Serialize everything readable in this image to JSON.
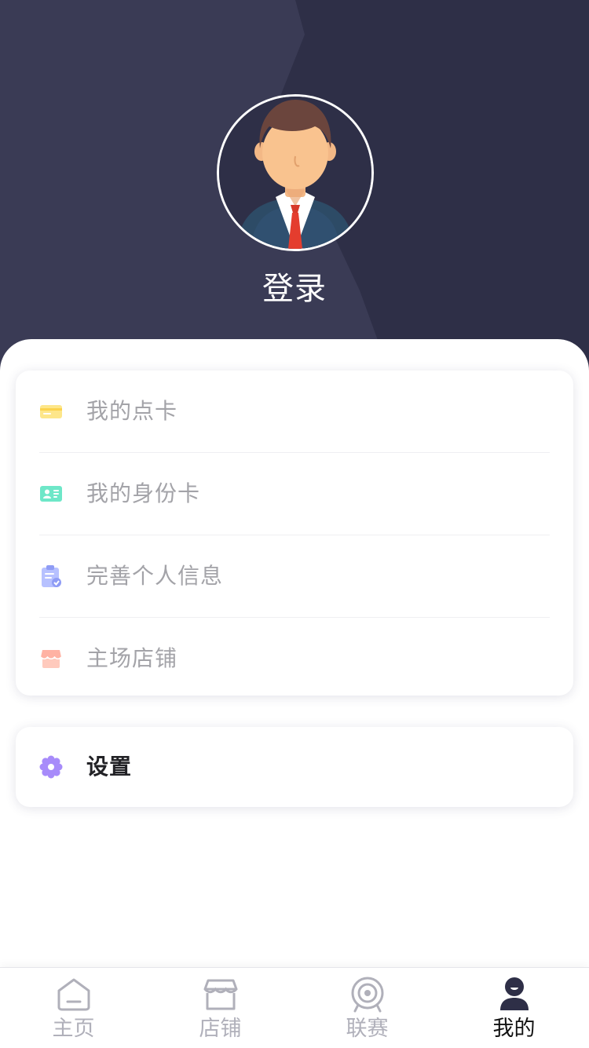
{
  "header": {
    "login_label": "登录"
  },
  "menu": {
    "items": [
      {
        "label": "我的点卡",
        "icon": "card-icon",
        "color": "#fde68a"
      },
      {
        "label": "我的身份卡",
        "icon": "id-card-icon",
        "color": "#6ee7c8"
      },
      {
        "label": "完善个人信息",
        "icon": "clipboard-check-icon",
        "color": "#a9b6ff"
      },
      {
        "label": "主场店铺",
        "icon": "store-icon",
        "color": "#ffb2a3"
      }
    ]
  },
  "settings": {
    "label": "设置",
    "icon": "gear-icon",
    "color": "#a78bfa"
  },
  "tabbar": {
    "tabs": [
      {
        "label": "主页",
        "icon": "home-icon",
        "active": false
      },
      {
        "label": "店铺",
        "icon": "shop-icon",
        "active": false
      },
      {
        "label": "联赛",
        "icon": "target-icon",
        "active": false
      },
      {
        "label": "我的",
        "icon": "user-icon",
        "active": true
      }
    ]
  },
  "colors": {
    "header_bg": "#2e2f47",
    "header_shard": "#3a3b55",
    "inactive_tab": "#b0b0ba",
    "active_tab": "#111111",
    "menu_text": "#a3a3a8"
  }
}
